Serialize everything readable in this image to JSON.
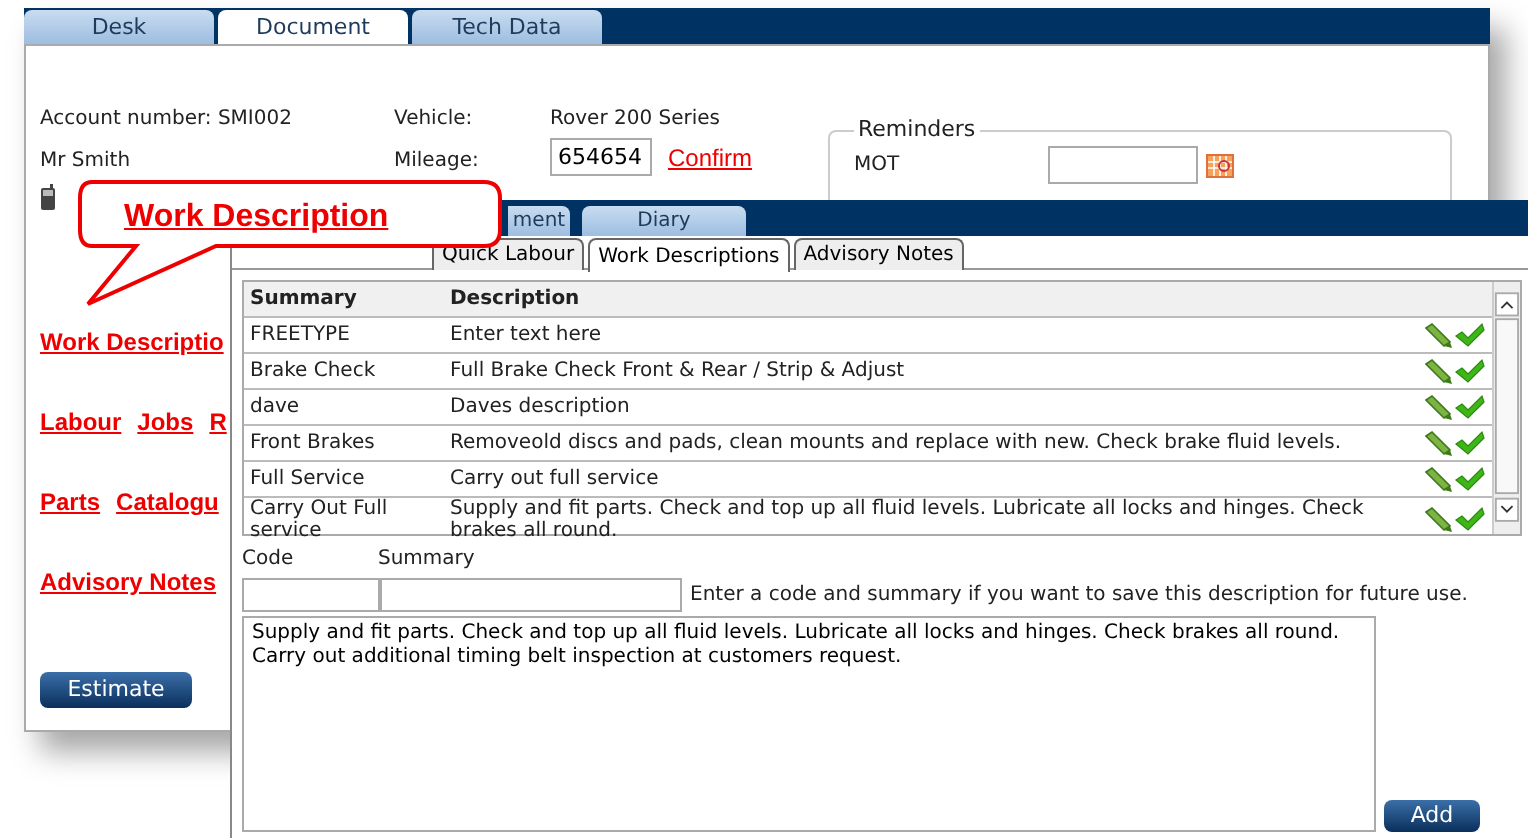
{
  "back_window": {
    "tabs": [
      {
        "label": "Desk",
        "selected": false
      },
      {
        "label": "Document",
        "selected": true
      },
      {
        "label": "Tech Data",
        "selected": false
      }
    ],
    "account": "Account number: SMI002",
    "customer": "Mr Smith",
    "vehicle_label": "Vehicle:",
    "vehicle": "Rover 200 Series",
    "mileage_label": "Mileage:",
    "mileage": "654654",
    "confirm_link": "Confirm",
    "reminders": {
      "title": "Reminders",
      "items": [
        {
          "label": "MOT"
        }
      ]
    },
    "link_rows": [
      {
        "links": [
          "Work Descriptio"
        ]
      },
      {
        "links": [
          "Labour",
          "Jobs",
          "R"
        ]
      },
      {
        "links": [
          "Parts",
          "Catalogu"
        ]
      },
      {
        "links": [
          "Advisory Notes"
        ]
      }
    ],
    "buttons": [
      "Estimate"
    ]
  },
  "callout": {
    "text": "Work Description"
  },
  "front_window": {
    "tabs": [
      {
        "label": "ment",
        "selected": false
      },
      {
        "label": "Diary",
        "selected": false
      }
    ],
    "subtabs": [
      {
        "label": "Quick Labour",
        "selected": false
      },
      {
        "label": "Work Descriptions",
        "selected": true
      },
      {
        "label": "Advisory Notes",
        "selected": false
      }
    ],
    "table": {
      "columns": [
        "Summary",
        "Description"
      ],
      "rows": [
        {
          "summary": "FREETYPE",
          "description": "Enter text here"
        },
        {
          "summary": "Brake Check",
          "description": "Full Brake Check Front & Rear / Strip & Adjust"
        },
        {
          "summary": "dave",
          "description": "Daves description"
        },
        {
          "summary": "Front Brakes",
          "description": "Removeold discs and pads, clean mounts and replace with new. Check brake fluid levels."
        },
        {
          "summary": "Full Service",
          "description": "Carry out full service"
        },
        {
          "summary": "Carry Out Full service",
          "description": "Supply and fit parts. Check and top up all fluid levels. Lubricate all locks and hinges. Check brakes all round."
        }
      ]
    },
    "code_label": "Code",
    "summary_label": "Summary",
    "hint": "Enter a code and summary if you want to save this description for future use.",
    "description_text": "Supply and fit parts. Check and top up all fluid levels. Lubricate all locks and hinges. Check brakes all round.\nCarry out additional timing belt inspection at customers request.",
    "add_button": "Add"
  }
}
